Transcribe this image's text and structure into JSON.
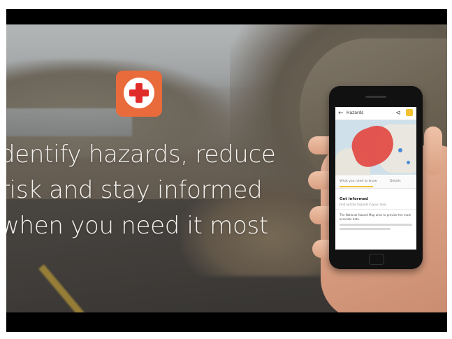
{
  "tagline": {
    "line1": "dentify hazards, reduce",
    "line2": "risk and stay informed",
    "line3": "when you need it most"
  },
  "phone_app": {
    "title": "Hazards",
    "back_icon": "arrow-left-icon",
    "share_icon": "share-icon",
    "tabs": [
      "What you need to know",
      "Details"
    ],
    "card_title": "Get informed",
    "card_subtitle": "Find out the hazards in your area",
    "card_body": "The National Hazard Map aims to provide the most accurate data."
  },
  "colors": {
    "logo_bg": "#e96b3b",
    "cross": "#e02b2b",
    "hazard_area": "#e2453f",
    "accent": "#f2c233"
  },
  "logo_icon": "red-cross-icon"
}
